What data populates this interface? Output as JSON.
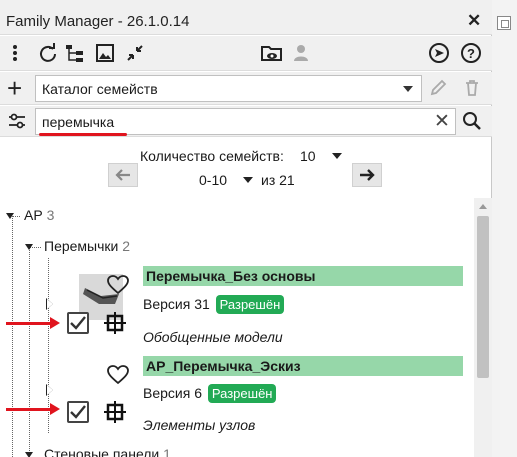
{
  "window": {
    "title": "Family Manager - 26.1.0.14",
    "close_label": "✕"
  },
  "toolbar": {
    "icons": [
      "more-vert-icon",
      "refresh-icon",
      "tree-icon",
      "image-icon",
      "collapse-icon",
      "folder-view-icon",
      "user-icon",
      "send-icon",
      "help-icon"
    ]
  },
  "catalog": {
    "add_label": "+",
    "selected": "Каталог семейств"
  },
  "search": {
    "query": "перемычка",
    "clear_label": "✕"
  },
  "pager": {
    "count_label": "Количество семейств:",
    "count_value": "10",
    "range": "0-10",
    "of_label": "из 21"
  },
  "tree": {
    "root": {
      "label": "АР",
      "count": "3"
    },
    "group": {
      "label": "Перемычки",
      "count": "2"
    },
    "items": [
      {
        "name": "Перемычка_Без основы",
        "version_label": "Версия 31",
        "status": "Разрешён",
        "category": "Обобщенные модели",
        "checked": true
      },
      {
        "name": "АР_Перемычка_Эскиз",
        "version_label": "Версия 6",
        "status": "Разрешён",
        "category": "Элементы узлов",
        "checked": true
      }
    ],
    "next_group": {
      "label": "Стеновые панели",
      "count": "1"
    }
  },
  "colors": {
    "accent_red": "#e0141e",
    "name_bar": "#96d7a9",
    "badge": "#22aa55"
  }
}
